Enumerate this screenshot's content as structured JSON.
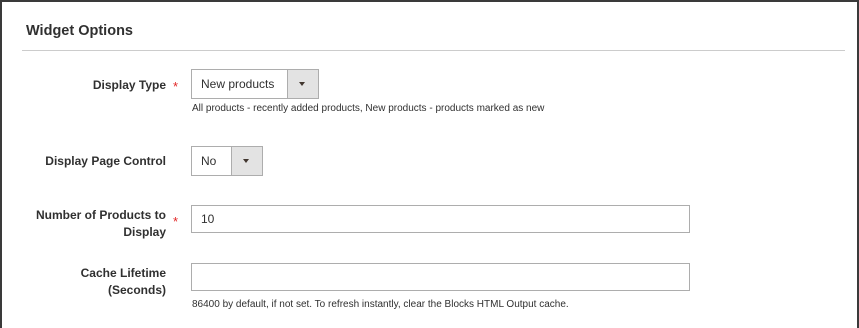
{
  "section": {
    "title": "Widget Options"
  },
  "fields": {
    "display_type": {
      "label": "Display Type",
      "required_mark": "*",
      "value": "New products",
      "note": "All products - recently added products, New products - products marked as new"
    },
    "display_page_control": {
      "label": "Display Page Control",
      "value": "No"
    },
    "number_of_products": {
      "label_line1": "Number of Products to",
      "label_line2": "Display",
      "required_mark": "*",
      "value": "10"
    },
    "cache_lifetime": {
      "label_line1": "Cache Lifetime",
      "label_line2": "(Seconds)",
      "value": "",
      "note": "86400 by default, if not set. To refresh instantly, clear the Blocks HTML Output cache."
    }
  },
  "icons": {
    "dropdown": "chevron-down-icon",
    "required": "asterisk"
  },
  "colors": {
    "required": "#e22626",
    "border": "#adadad",
    "select_button": "#e3e3e3"
  }
}
